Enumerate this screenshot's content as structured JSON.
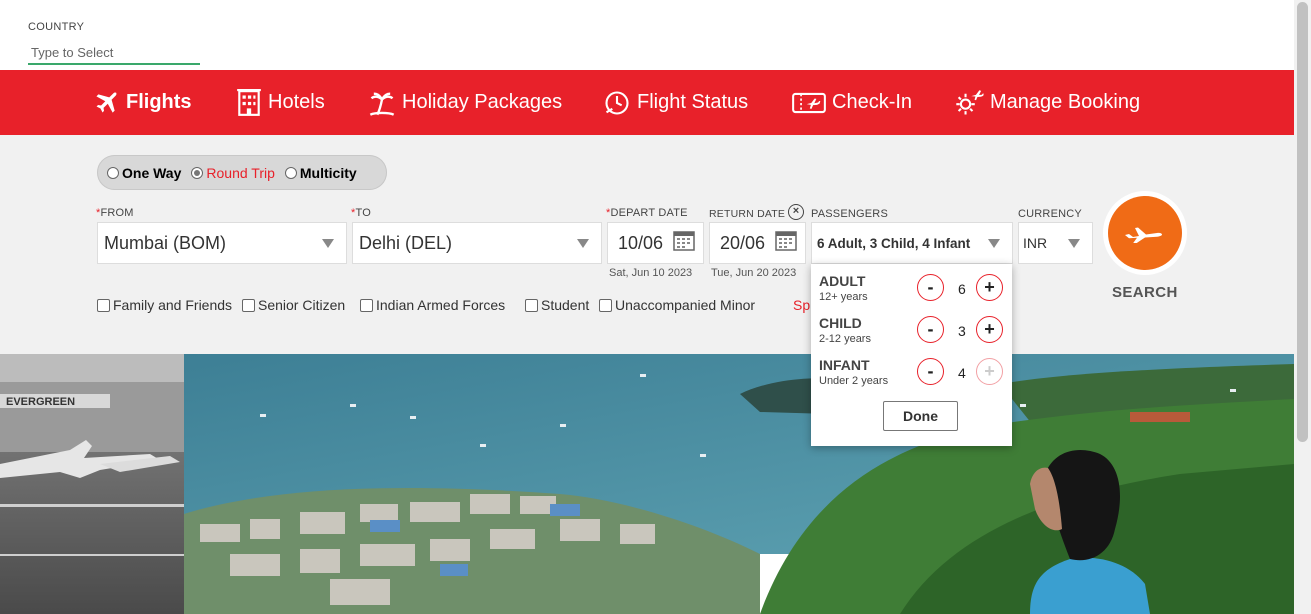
{
  "country": {
    "label": "COUNTRY",
    "placeholder": "Type to Select"
  },
  "nav": [
    {
      "label": "Flights",
      "icon": "plane-icon",
      "active": true
    },
    {
      "label": "Hotels",
      "icon": "hotel-icon"
    },
    {
      "label": "Holiday Packages",
      "icon": "palm-tree-icon"
    },
    {
      "label": "Flight Status",
      "icon": "clock-plane-icon"
    },
    {
      "label": "Check-In",
      "icon": "ticket-plane-icon"
    },
    {
      "label": "Manage Booking",
      "icon": "gear-plane-icon"
    }
  ],
  "trip_type": {
    "options": [
      "One Way",
      "Round Trip",
      "Multicity"
    ],
    "selected": "Round Trip"
  },
  "from": {
    "label": "FROM",
    "value": "Mumbai (BOM)"
  },
  "to": {
    "label": "TO",
    "value": "Delhi (DEL)"
  },
  "depart": {
    "label": "DEPART DATE",
    "value": "10/06",
    "sub": "Sat, Jun 10 2023"
  },
  "return": {
    "label": "RETURN DATE",
    "value": "20/06",
    "sub": "Tue, Jun 20 2023",
    "clear": "×"
  },
  "passengers": {
    "label": "PASSENGERS",
    "value": "6 Adult, 3 Child, 4 Infant",
    "rows": [
      {
        "name": "ADULT",
        "sub": "12+ years",
        "count": "6",
        "minus": "-",
        "plus": "+"
      },
      {
        "name": "CHILD",
        "sub": "2-12 years",
        "count": "3",
        "minus": "-",
        "plus": "+"
      },
      {
        "name": "INFANT",
        "sub": "Under 2 years",
        "count": "4",
        "minus": "-",
        "plus": "+"
      }
    ],
    "done": "Done"
  },
  "currency": {
    "label": "CURRENCY",
    "value": "INR"
  },
  "search": {
    "label": "SEARCH"
  },
  "concessions": [
    "Family and Friends",
    "Senior Citizen",
    "Indian Armed Forces",
    "Student",
    "Unaccompanied Minor"
  ],
  "partial_text": "Sp",
  "hero_sign": "EVERGREEN",
  "colors": {
    "brand_red": "#e8212a",
    "search_orange": "#f06b16",
    "field_bg": "#f1f1f1"
  }
}
